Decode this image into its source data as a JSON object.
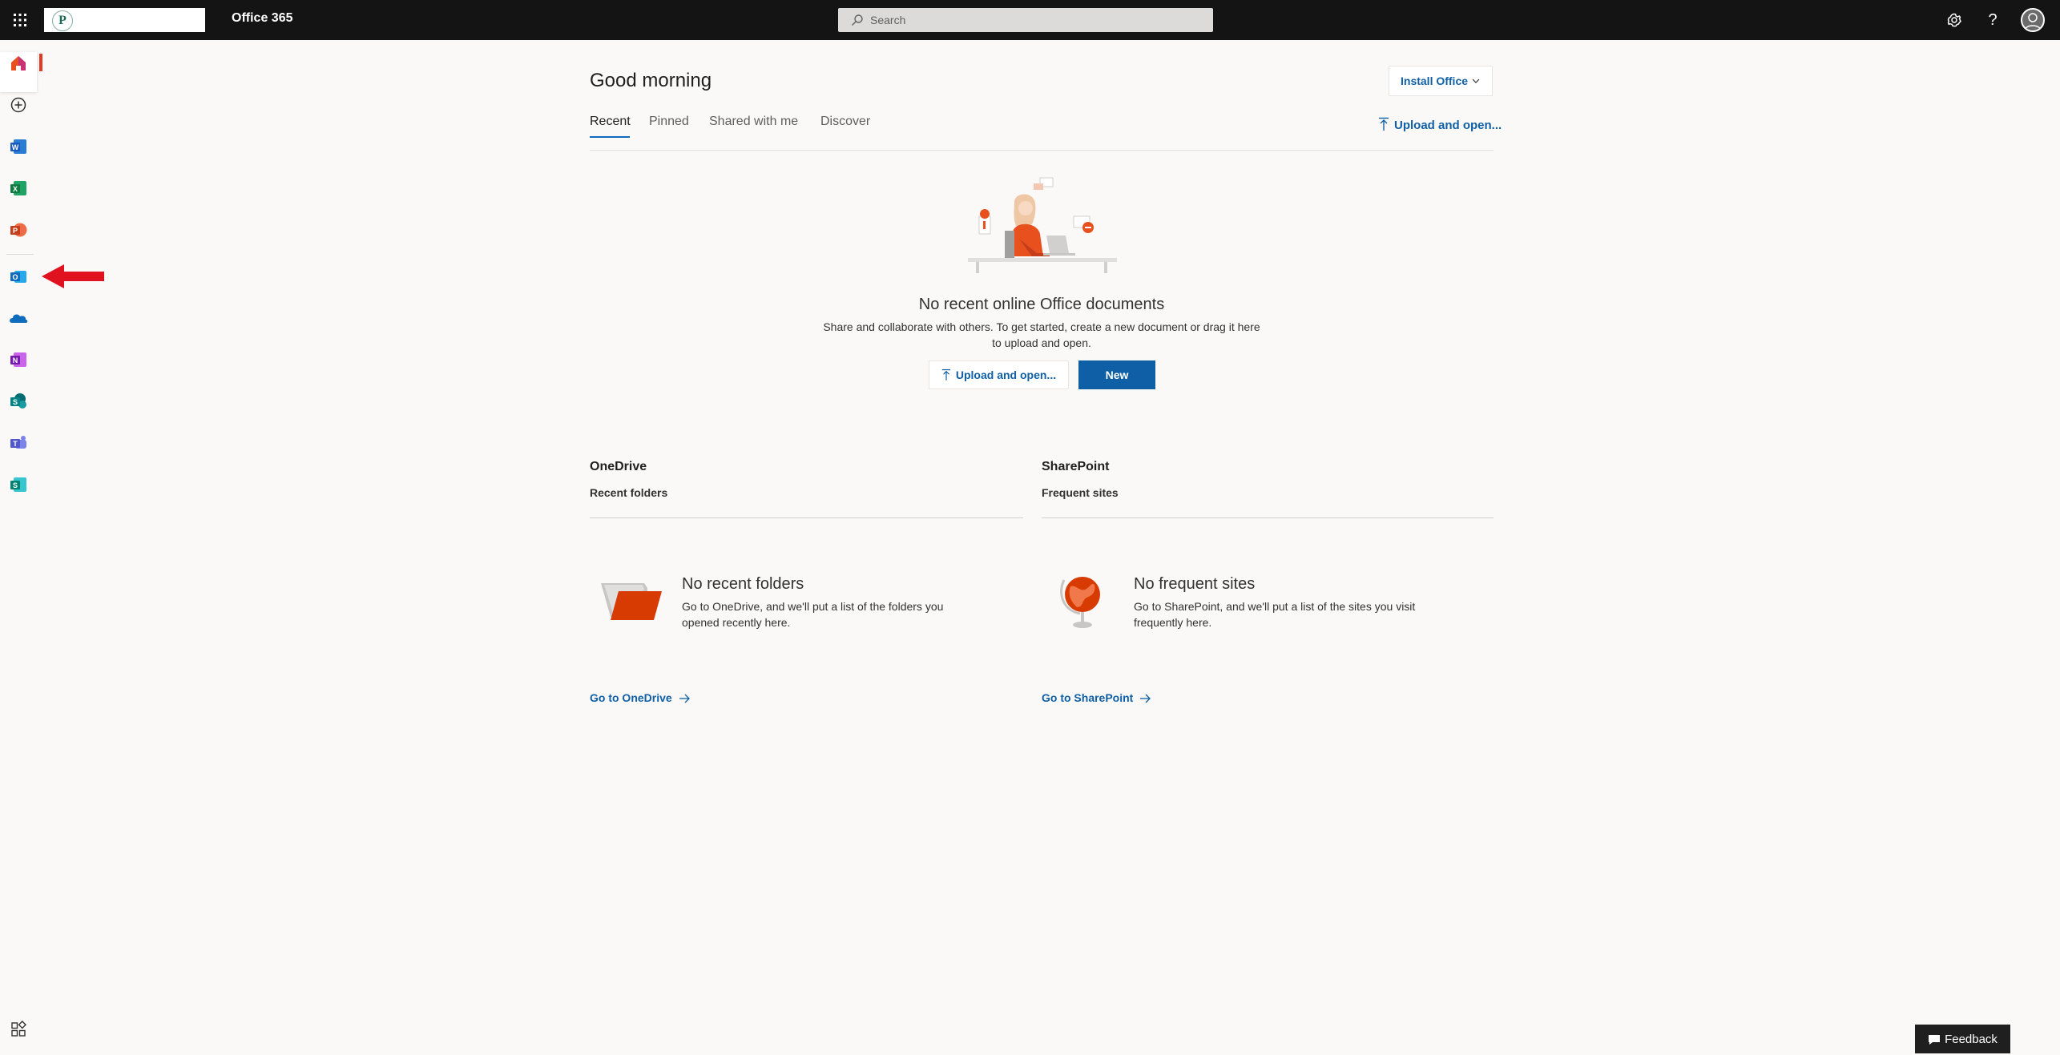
{
  "header": {
    "org_logo_letter": "P",
    "app_title": "Office 365",
    "search_placeholder": "Search",
    "help_label": "?",
    "icons": [
      "waffle-icon",
      "gear-icon",
      "help-icon",
      "avatar"
    ]
  },
  "rail": {
    "items": [
      {
        "name": "home",
        "icon": "home-icon",
        "active": true
      },
      {
        "name": "create",
        "icon": "plus-circle-icon"
      },
      {
        "name": "word",
        "icon": "word-icon",
        "letter": "W",
        "color": "#185abd"
      },
      {
        "name": "excel",
        "icon": "excel-icon",
        "letter": "X",
        "color": "#107c41"
      },
      {
        "name": "powerpoint",
        "icon": "powerpoint-icon",
        "letter": "P",
        "color": "#c43e1c"
      },
      {
        "name": "outlook",
        "icon": "outlook-icon",
        "letter": "O",
        "color": "#0f6cbd"
      },
      {
        "name": "onedrive",
        "icon": "onedrive-icon",
        "color": "#0f6cbd"
      },
      {
        "name": "onenote",
        "icon": "onenote-icon",
        "letter": "N",
        "color": "#7719aa"
      },
      {
        "name": "sharepoint",
        "icon": "sharepoint-icon",
        "letter": "S",
        "color": "#038387"
      },
      {
        "name": "teams",
        "icon": "teams-icon",
        "letter": "T",
        "color": "#5059c9"
      },
      {
        "name": "sway",
        "icon": "sway-icon",
        "letter": "S",
        "color": "#008272"
      }
    ],
    "annotation_arrow_color": "#e0121f"
  },
  "main": {
    "greeting": "Good morning",
    "install_button": "Install Office",
    "tabs": [
      "Recent",
      "Pinned",
      "Shared with me",
      "Discover"
    ],
    "upload_link": "Upload and open...",
    "empty": {
      "title": "No recent online Office documents",
      "description_line1": "Share and collaborate with others. To get started, create a new document or drag it here",
      "description_line2": "to upload and open.",
      "upload_button": "Upload and open...",
      "new_button": "New"
    }
  },
  "onedrive": {
    "title": "OneDrive",
    "subtitle": "Recent folders",
    "empty_title": "No recent folders",
    "empty_line1": "Go to OneDrive, and we'll put a list of the folders you",
    "empty_line2": "opened recently here.",
    "link": "Go to OneDrive"
  },
  "sharepoint": {
    "title": "SharePoint",
    "subtitle": "Frequent sites",
    "empty_title": "No frequent sites",
    "empty_line1": "Go to SharePoint, and we'll put a list of the sites you visit",
    "empty_line2": "frequently here.",
    "link": "Go to SharePoint"
  },
  "footer": {
    "feedback": "Feedback"
  },
  "colors": {
    "accent": "#0f5fa6",
    "topbar": "#141414",
    "background": "#faf9f8"
  }
}
